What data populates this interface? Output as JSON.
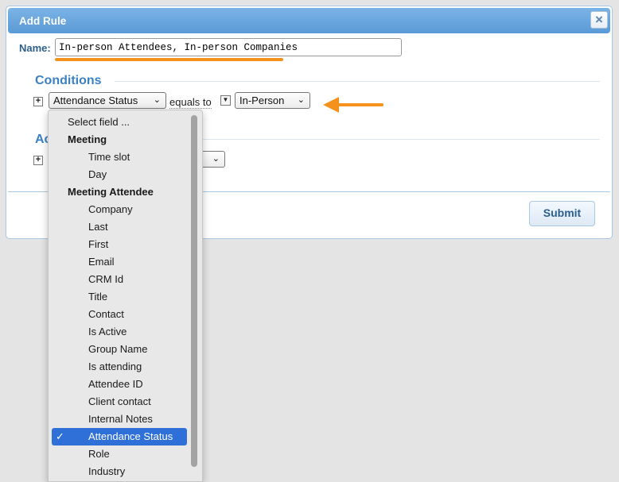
{
  "dialog": {
    "title": "Add Rule",
    "close_icon": "×"
  },
  "name": {
    "label": "Name:",
    "value": "In-person Attendees, In-person Companies",
    "underline_color": "#f5921e"
  },
  "conditions": {
    "title": "Conditions",
    "plus_icon": "+",
    "field_select": "Attendance Status",
    "operator": "equals to",
    "value_select": "In-Person",
    "arrow_color": "#f5921e"
  },
  "actions": {
    "title_partial": "Ac",
    "plus_icon": "+"
  },
  "footer": {
    "submit_label": "Submit"
  },
  "dropdown": {
    "selected_check": "✓",
    "items": [
      {
        "label": "Select field ...",
        "kind": "first"
      },
      {
        "label": "Meeting",
        "kind": "head"
      },
      {
        "label": "Time slot",
        "kind": "opt"
      },
      {
        "label": "Day",
        "kind": "opt"
      },
      {
        "label": "Meeting Attendee",
        "kind": "head"
      },
      {
        "label": "Company",
        "kind": "opt"
      },
      {
        "label": "Last",
        "kind": "opt"
      },
      {
        "label": "First",
        "kind": "opt"
      },
      {
        "label": "Email",
        "kind": "opt"
      },
      {
        "label": "CRM Id",
        "kind": "opt"
      },
      {
        "label": "Title",
        "kind": "opt"
      },
      {
        "label": "Contact",
        "kind": "opt"
      },
      {
        "label": "Is Active",
        "kind": "opt"
      },
      {
        "label": "Group Name",
        "kind": "opt"
      },
      {
        "label": "Is attending",
        "kind": "opt"
      },
      {
        "label": "Attendee ID",
        "kind": "opt"
      },
      {
        "label": "Client contact",
        "kind": "opt"
      },
      {
        "label": "Internal Notes",
        "kind": "opt"
      },
      {
        "label": "Attendance Status",
        "kind": "sel"
      },
      {
        "label": "Role",
        "kind": "opt"
      },
      {
        "label": "Industry",
        "kind": "opt"
      }
    ]
  },
  "colors": {
    "accent": "#3a82c4",
    "selection": "#2f6fd8",
    "titlebar": "#6aa6de"
  }
}
